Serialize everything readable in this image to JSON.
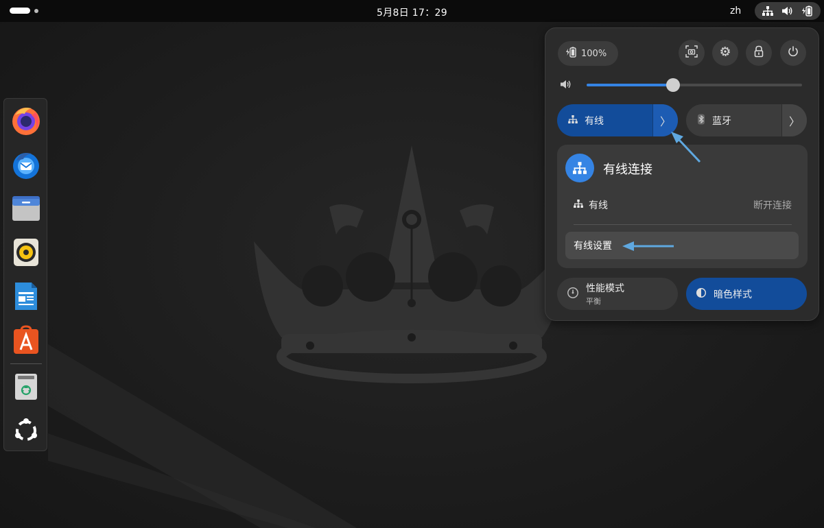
{
  "topbar": {
    "clock": "5月8日  17：29",
    "language": "zh"
  },
  "dock": {
    "apps": [
      "firefox-icon",
      "thunderbird-icon",
      "files-icon",
      "rhythmbox-icon",
      "writer-icon",
      "app-center-icon",
      "trash-icon",
      "show-apps-icon"
    ]
  },
  "quick_settings": {
    "battery_label": "100%",
    "volume_level": 0.4,
    "wired_toggle_label": "有线",
    "bluetooth_toggle_label": "蓝牙",
    "submenu": {
      "title": "有线连接",
      "connection_label": "有线",
      "disconnect_label": "断开连接",
      "settings_label": "有线设置"
    },
    "power_mode": {
      "title": "性能模式",
      "subtitle": "平衡"
    },
    "dark_style_label": "暗色样式"
  },
  "colors": {
    "accent": "#3584e4",
    "toggle_active": "#124c9a",
    "annotation_arrow": "#5fa8e0"
  }
}
